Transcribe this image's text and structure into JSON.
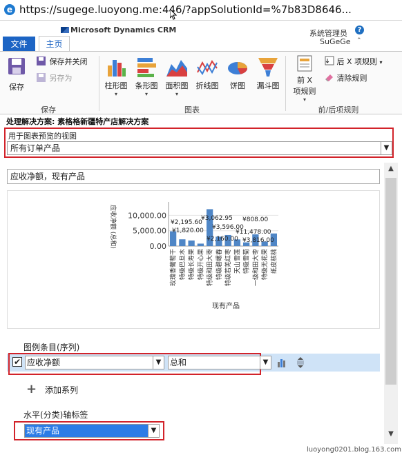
{
  "browser": {
    "url": "https://sugege.luoyong.me:446/?appSolutionId=%7b83D8646..."
  },
  "header": {
    "logo_text": "Microsoft Dynamics CRM",
    "user_name": "系统管理员",
    "org_name": "SuGeGe",
    "help": "?"
  },
  "tabs": {
    "file": "文件",
    "home": "主页"
  },
  "ribbon": {
    "save": "保存",
    "save_close": "保存并关闭",
    "save_as": "另存为",
    "save_group": "保存",
    "chart_types": [
      {
        "label": "柱形图",
        "icon": "column-chart-icon",
        "dropdown": true
      },
      {
        "label": "条形图",
        "icon": "bar-chart-icon",
        "dropdown": true
      },
      {
        "label": "面积图",
        "icon": "area-chart-icon",
        "dropdown": true
      },
      {
        "label": "折线图",
        "icon": "line-chart-icon",
        "dropdown": false
      },
      {
        "label": "饼图",
        "icon": "pie-chart-icon",
        "dropdown": false
      },
      {
        "label": "漏斗图",
        "icon": "funnel-chart-icon",
        "dropdown": false
      }
    ],
    "chart_group": "图表",
    "top_x_line1": "前 X",
    "top_x_line2": "项规则",
    "bottom_x": "后 X 项规则",
    "clear_rules": "清除规则",
    "rules_group": "前/后项规则"
  },
  "solution_title": "处理解决方案: 素格格新疆特产店解决方案",
  "view": {
    "label": "用于图表预览的视图",
    "selected": "所有订单产品"
  },
  "chart_name": "应收净额，现有产品",
  "chart_data": {
    "type": "bar",
    "ylabel": "应收净额 (总和)",
    "xlabel": "现有产品",
    "ylim": [
      0,
      13000
    ],
    "y_ticks": [
      "0.00",
      "5,000.00",
      "10,000.00"
    ],
    "categories": [
      "玫瑰香葡萄干",
      "特级巴旦木",
      "特级长寿果",
      "特级开心果",
      "特级和田大枣",
      "特级碧螺春",
      "特级若羌红枣",
      "天山雪莲",
      "特级雪菊",
      "一级和田大枣",
      "特级无花果",
      "纸皮核桃"
    ],
    "values": [
      4800,
      2196,
      1820,
      800,
      12000,
      3063,
      3596,
      2160,
      1200,
      3816,
      1478,
      4100
    ],
    "data_labels": [
      "¥2,195.60",
      "¥1,820.00",
      "¥3,062.95",
      "¥3,596.00",
      "¥2,160.00",
      "¥808.00",
      "¥11,478.00",
      "¥3,816.00"
    ]
  },
  "series_section": {
    "header": "图例条目(序列)",
    "field": "应收净额",
    "aggregate": "总和",
    "checked": true,
    "add_series": "添加系列"
  },
  "category_section": {
    "header": "水平(分类)轴标签",
    "selected": "现有产品"
  },
  "watermark": "luoyong0201.blog.163.com"
}
